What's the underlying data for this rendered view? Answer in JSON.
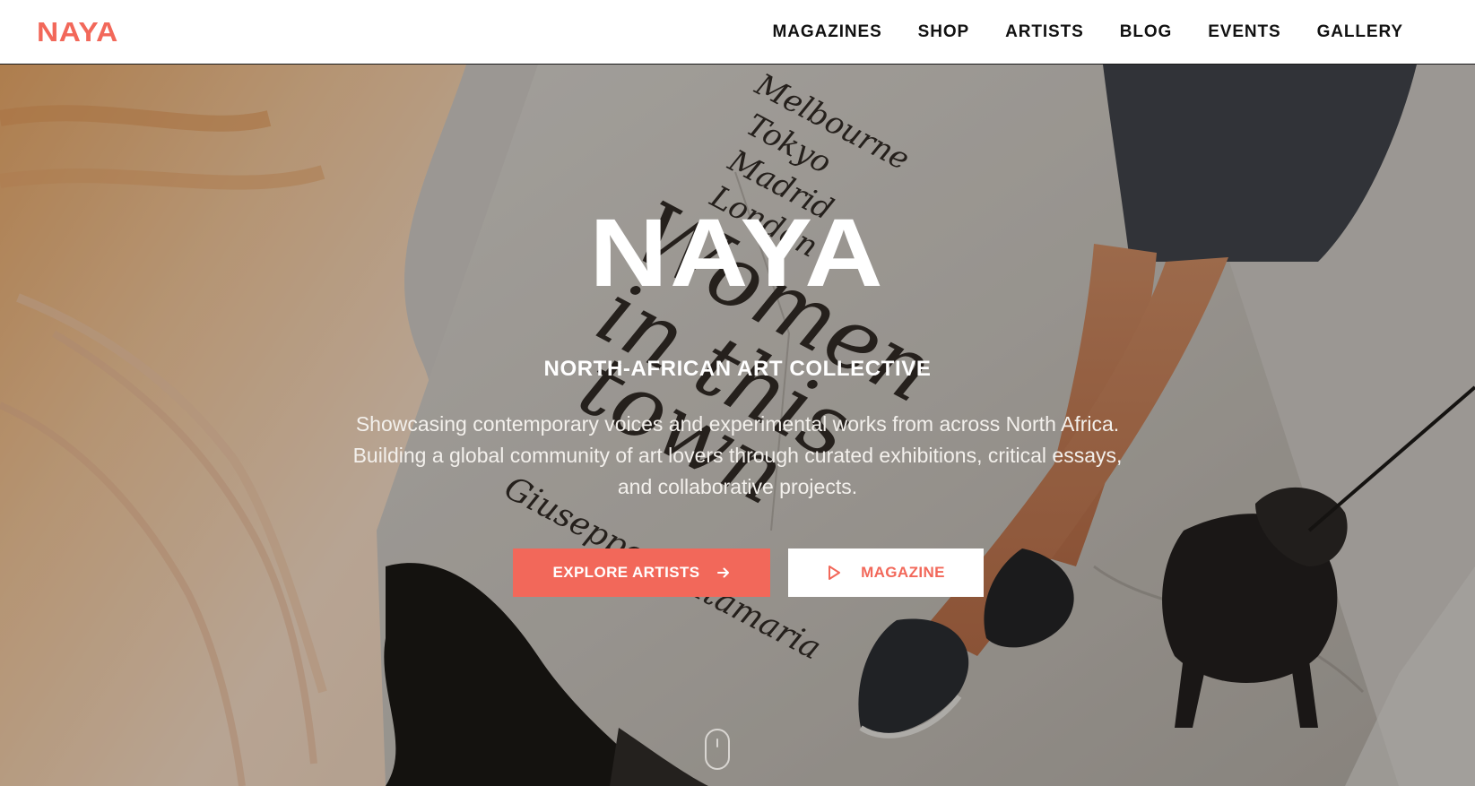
{
  "header": {
    "logo": "NAYA",
    "nav": [
      "MAGAZINES",
      "SHOP",
      "ARTISTS",
      "BLOG",
      "EVENTS",
      "GALLERY"
    ]
  },
  "hero": {
    "title": "NAYA",
    "subtitle": "NORTH-AFRICAN ART COLLECTIVE",
    "description": [
      "Showcasing contemporary voices and experimental works from across North Africa.",
      "Building a global community of art lovers through curated exhibitions, critical essays,",
      "and collaborative projects."
    ],
    "primary_button": {
      "label": "EXPLORE ARTISTS",
      "icon": "arrow-right-icon"
    },
    "secondary_button": {
      "label": "MAGAZINE",
      "icon": "play-icon"
    },
    "background_print": [
      "Melbourne",
      "Tokyo",
      "Madrid",
      "London",
      "Women",
      "in this",
      "town",
      "Giuseppe Santamaria"
    ],
    "scroll_icon": "mouse-scroll-icon"
  },
  "colors": {
    "accent": "#f2685a",
    "header_bg": "#ffffff",
    "nav_text": "#111111",
    "hero_text": "#ffffff"
  }
}
